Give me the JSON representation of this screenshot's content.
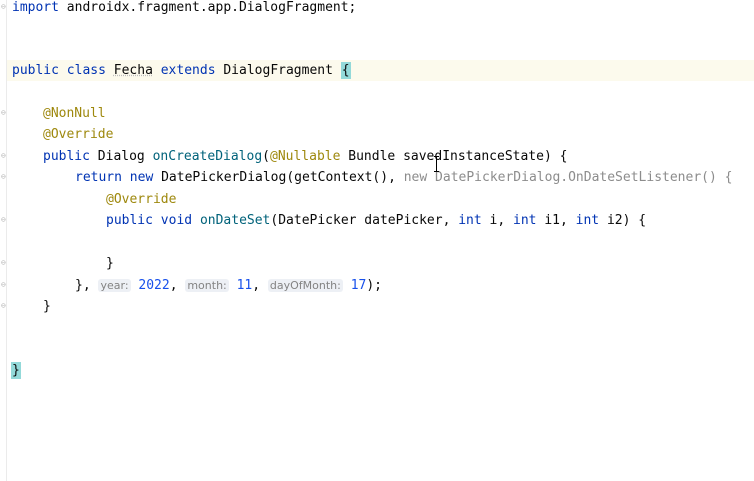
{
  "code": {
    "l1": {
      "import_kw": "import",
      "import_path": " androidx.fragment.app.DialogFragment;"
    },
    "l2": {
      "public": "public",
      "class": "class",
      "name": "Fecha",
      "extends": "extends",
      "parent": "DialogFragment",
      "brace": "{"
    },
    "l3": {
      "ann": "@NonNull"
    },
    "l4": {
      "ann": "@Override"
    },
    "l5": {
      "public": "public",
      "type": "Dialog",
      "fn": "onCreateDialog",
      "paren": "(",
      "ann": "@Nullable",
      "rest": " Bundle savedInstanceState) {"
    },
    "l6": {
      "return": "return",
      "new": "new",
      "call": " DatePickerDialog(getContext(), ",
      "hint_new": "new DatePickerDialog.OnDateSetListener() {"
    },
    "l7": {
      "ann": "@Override"
    },
    "l8": {
      "public": "public",
      "void": "void",
      "fn": "onDateSet",
      "p1": "(DatePicker datePicker, ",
      "int1": "int",
      "p2": " i, ",
      "int2": "int",
      "p3": " i1, ",
      "int3": "int",
      "p4": " i2) {"
    },
    "l9": {
      "brace": "}"
    },
    "l10": {
      "start": "}, ",
      "hint_year": "year:",
      "year": "2022",
      "c1": ", ",
      "hint_month": "month:",
      "month": "11",
      "c2": ", ",
      "hint_day": "dayOfMonth:",
      "day": "17",
      "end": ");"
    },
    "l11": {
      "brace": "}"
    },
    "l12": {
      "brace": "}"
    }
  },
  "colors": {
    "keyword": "#0033b3",
    "annotation": "#9e880d",
    "function": "#00627a",
    "number": "#1750eb",
    "hint": "#8c8c8c"
  }
}
